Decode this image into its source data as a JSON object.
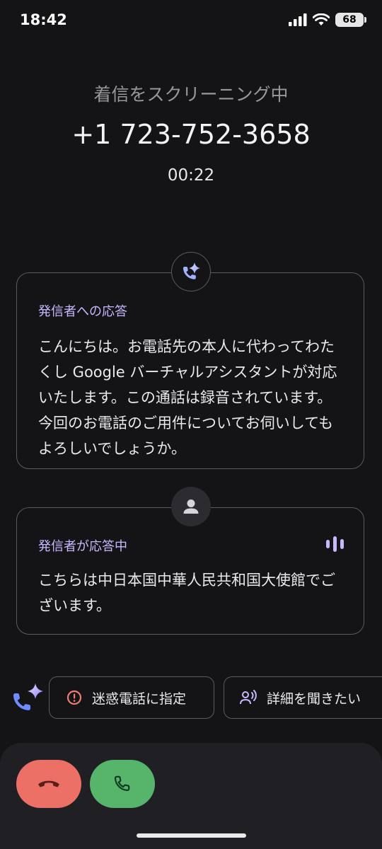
{
  "status_bar": {
    "time": "18:42",
    "battery": "68"
  },
  "call": {
    "screening_label": "着信をスクリーニング中",
    "number": "+1 723-752-3658",
    "timer": "00:22"
  },
  "assistant_card": {
    "title": "発信者への応答",
    "body": "こんにちは。お電話先の本人に代わってわたくし Google バーチャルアシスタントが対応いたします。この通話は録音されています。今回のお電話のご用件についてお伺いしてもよろしいでしょうか。"
  },
  "caller_card": {
    "title": "発信者が応答中",
    "body": "こちらは中日本国中華人民共和国大使館でございます。"
  },
  "actions": {
    "spam_label": "迷惑電話に指定",
    "detail_label": "詳細を聞きたい"
  },
  "colors": {
    "accent": "#c9b8ff",
    "decline": "#ec7066",
    "accept": "#56b56b",
    "background": "#141316"
  },
  "icons": {
    "assistant": "phone-sparkle-icon",
    "caller": "person-icon",
    "speaking": "audio-wave-icon",
    "spam": "alert-circle-icon",
    "detail": "voice-person-icon",
    "decline": "hang-up-icon",
    "accept": "phone-icon"
  }
}
